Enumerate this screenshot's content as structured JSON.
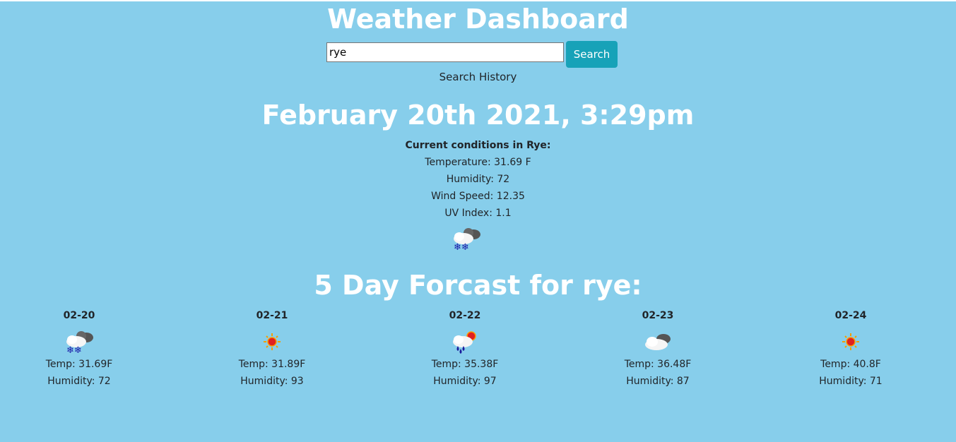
{
  "header": {
    "title": "Weather Dashboard"
  },
  "search": {
    "value": "rye",
    "button_label": "Search",
    "history_label": "Search History"
  },
  "current": {
    "datetime": "February 20th 2021, 3:29pm",
    "heading": "Current conditions in Rye:",
    "temperature": "Temperature: 31.69 F",
    "humidity": "Humidity: 72",
    "wind": "Wind Speed: 12.35",
    "uv": "UV Index: 1.1",
    "icon": "snow-cloud-icon"
  },
  "forecast": {
    "title": "5 Day Forcast for rye:",
    "days": [
      {
        "date": "02-20",
        "icon": "snow-cloud-icon",
        "temp": "Temp: 31.69F",
        "humidity": "Humidity: 72"
      },
      {
        "date": "02-21",
        "icon": "sun-icon",
        "temp": "Temp: 31.89F",
        "humidity": "Humidity: 93"
      },
      {
        "date": "02-22",
        "icon": "rain-sun-icon",
        "temp": "Temp: 35.38F",
        "humidity": "Humidity: 97"
      },
      {
        "date": "02-23",
        "icon": "cloud-icon",
        "temp": "Temp: 36.48F",
        "humidity": "Humidity: 87"
      },
      {
        "date": "02-24",
        "icon": "sun-icon",
        "temp": "Temp: 40.8F",
        "humidity": "Humidity: 71"
      }
    ]
  },
  "colors": {
    "background": "#87ceeb",
    "button": "#17a2b8",
    "heading": "#ffffff"
  }
}
